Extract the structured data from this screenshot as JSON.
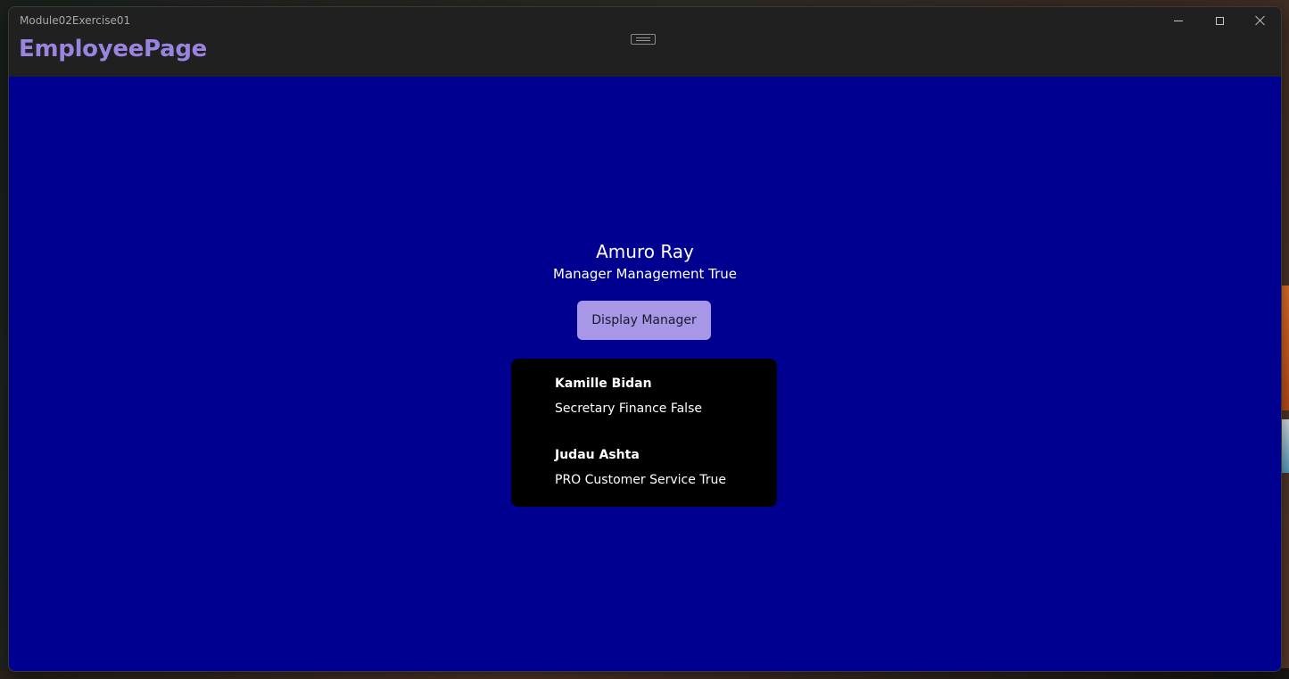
{
  "window": {
    "title": "Module02Exercise01",
    "caption_icons": [
      "minimize-icon",
      "maximize-icon",
      "close-icon"
    ]
  },
  "page": {
    "heading": "EmployeePage",
    "accent_color": "#9a84e0",
    "background_color": "#000090"
  },
  "manager": {
    "name": "Amuro Ray",
    "detail": "Manager Management True"
  },
  "button": {
    "label": "Display Manager",
    "color": "#a896e6"
  },
  "employees": [
    {
      "name": "Kamille Bidan",
      "detail": "Secretary Finance False"
    },
    {
      "name": "Judau Ashta",
      "detail": "PRO Customer Service True"
    }
  ]
}
